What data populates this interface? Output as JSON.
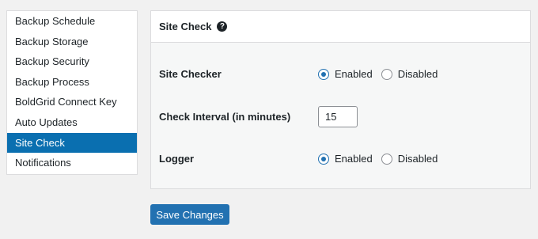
{
  "sidebar": {
    "items": [
      {
        "label": "Backup Schedule"
      },
      {
        "label": "Backup Storage"
      },
      {
        "label": "Backup Security"
      },
      {
        "label": "Backup Process"
      },
      {
        "label": "BoldGrid Connect Key"
      },
      {
        "label": "Auto Updates"
      },
      {
        "label": "Site Check",
        "active": true
      },
      {
        "label": "Notifications"
      }
    ]
  },
  "panel": {
    "title": "Site Check",
    "help_icon": "?",
    "site_checker": {
      "label": "Site Checker",
      "enabled_label": "Enabled",
      "disabled_label": "Disabled",
      "selected": "Enabled"
    },
    "check_interval": {
      "label": "Check Interval (in minutes)",
      "value": "15"
    },
    "logger": {
      "label": "Logger",
      "enabled_label": "Enabled",
      "disabled_label": "Disabled",
      "selected": "Enabled"
    }
  },
  "actions": {
    "save_label": "Save Changes"
  },
  "colors": {
    "accent": "#2271b1",
    "active_nav": "#0a6fb0",
    "panel_bg": "#f6f7f7",
    "page_bg": "#f1f1f1"
  }
}
